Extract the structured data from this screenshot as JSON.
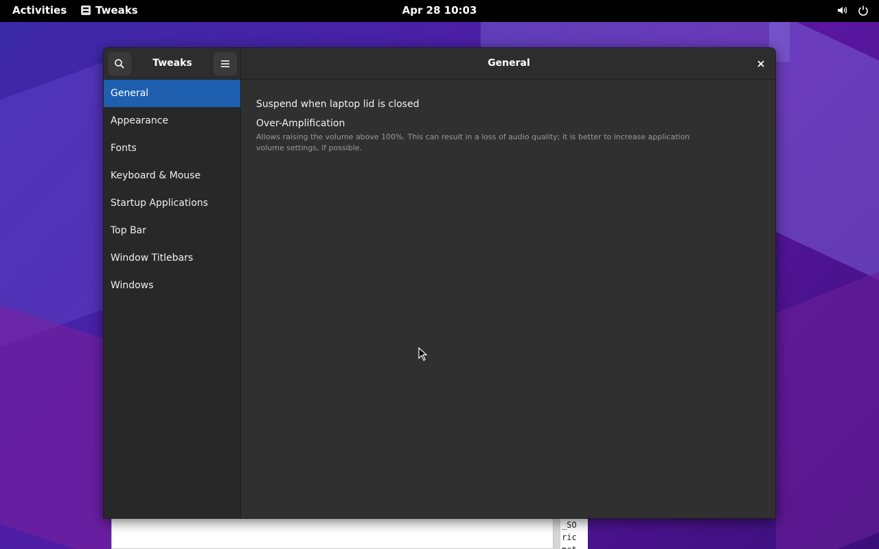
{
  "topbar": {
    "activities": "Activities",
    "app_name": "Tweaks",
    "clock": "Apr 28  10:03"
  },
  "window": {
    "sidebar_title": "Tweaks",
    "title": "General",
    "nav": [
      {
        "label": "General",
        "active": true
      },
      {
        "label": "Appearance"
      },
      {
        "label": "Fonts"
      },
      {
        "label": "Keyboard & Mouse"
      },
      {
        "label": "Startup Applications"
      },
      {
        "label": "Top Bar"
      },
      {
        "label": "Window Titlebars"
      },
      {
        "label": "Windows"
      }
    ],
    "settings": {
      "suspend": {
        "label": "Suspend when laptop lid is closed",
        "enabled": true
      },
      "over_amplification": {
        "label": "Over-Amplification",
        "description": "Allows raising the volume above 100%. This can result in a loss of audio quality; it is better to increase application volume settings, if possible.",
        "enabled": false
      }
    }
  },
  "background_terminal": {
    "lines": [
      "_SO",
      "ric",
      "met"
    ]
  },
  "colors": {
    "accent": "#1e5fb0",
    "switch_on": "#2a70d8",
    "window_bg": "#303030"
  }
}
